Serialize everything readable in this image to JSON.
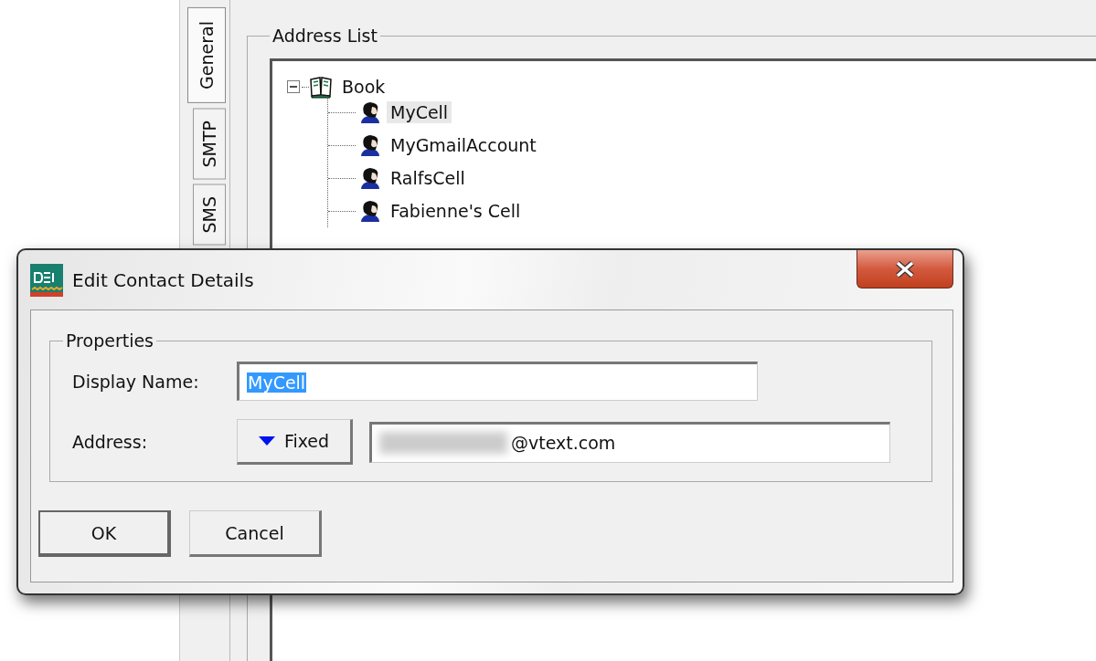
{
  "tabs": [
    {
      "label": "General",
      "selected": true
    },
    {
      "label": "SMTP",
      "selected": false
    },
    {
      "label": "SMS",
      "selected": false
    }
  ],
  "address_list": {
    "title": "Address List",
    "tree": [
      {
        "label": "Book",
        "kind": "book",
        "expanded": true,
        "selected": false,
        "children": [
          {
            "label": "MyCell",
            "kind": "contact",
            "selected": true
          },
          {
            "label": "MyGmailAccount",
            "kind": "contact",
            "selected": false
          },
          {
            "label": "RalfsCell",
            "kind": "contact",
            "selected": false
          },
          {
            "label": "Fabienne's Cell",
            "kind": "contact",
            "selected": false
          }
        ]
      }
    ]
  },
  "dialog": {
    "title": "Edit Contact Details",
    "group": "Properties",
    "display_name": {
      "label": "Display Name:",
      "value": "MyCell",
      "text_selected": true
    },
    "address": {
      "label": "Address:",
      "mode": "Fixed",
      "value": "@vtext.com"
    },
    "buttons": [
      "OK",
      "Cancel"
    ]
  }
}
